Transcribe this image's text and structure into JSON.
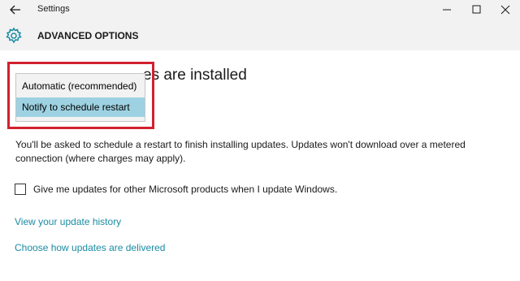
{
  "window": {
    "title": "Settings",
    "back_icon": "back-arrow-icon",
    "controls": [
      "minimize-icon",
      "maximize-icon",
      "close-icon"
    ]
  },
  "header": {
    "icon": "gear-icon",
    "title": "ADVANCED OPTIONS"
  },
  "section": {
    "heading_partial": "Choose how updates are installed",
    "heading_visible": "es are installed"
  },
  "dropdown": {
    "options": [
      "Automatic (recommended)",
      "Notify to schedule restart"
    ],
    "selected": "Notify to schedule restart"
  },
  "description": "You'll be asked to schedule a restart to finish installing updates. Updates won't download over a metered connection (where charges may apply).",
  "checkbox": {
    "label": "Give me updates for other Microsoft products when I update Windows.",
    "checked": false
  },
  "links": {
    "history": "View your update history",
    "delivery": "Choose how updates are delivered"
  },
  "colors": {
    "highlight_border": "#d2202e",
    "selected_option": "#9ed2e2",
    "link": "#1a8ba3",
    "accent": "#1a8ba3"
  }
}
